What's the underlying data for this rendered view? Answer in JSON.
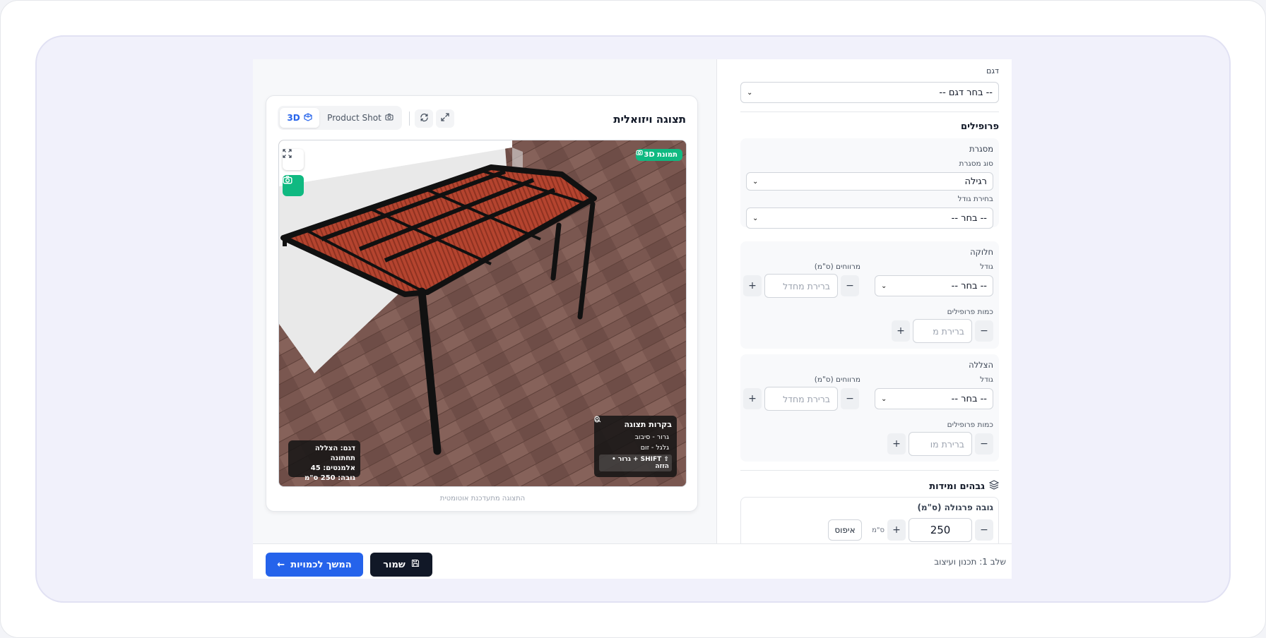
{
  "visualization": {
    "title": "תצוגה ויזואלית",
    "tabs": {
      "tab_3d": "3D",
      "tab_product_shot": "Product Shot"
    },
    "badge": "תמונת 3D",
    "controls": {
      "title": "בקרות תצוגה",
      "drag_rotate": "גרור - סיבוב",
      "scroll_zoom": "גלגל - זום",
      "shift_pan": "SHIFT + גרור • הזזה"
    },
    "info": {
      "model": "דגם: הצללה תחתונה",
      "elements": "אלמנטים: 45",
      "height": "גובה: 250 ס\"מ"
    },
    "caption": "התצוגה מתעדכנת אוטומטית",
    "colors": {
      "accent": "#10b981",
      "slat": "#b5442f",
      "frame": "#111111"
    }
  },
  "config": {
    "model": {
      "label": "דגם",
      "value": "-- בחר דגם --"
    },
    "profiles": {
      "title": "פרופילים",
      "frame": {
        "label": "מסגרת",
        "type_label": "סוג מסגרת",
        "type_value": "רגילה",
        "size_label": "בחירת גודל",
        "size_value": "-- בחר --"
      },
      "divider": {
        "label": "חלוקה",
        "size_label": "גודל",
        "size_value": "-- בחר --",
        "gap_label": "מרווחים (ס\"מ)",
        "gap_placeholder": "ברירת מחדל",
        "count_label": "כמות פרופילים",
        "count_placeholder": "ברירת מ"
      },
      "shading": {
        "label": "הצללה",
        "size_label": "גודל",
        "size_value": "-- בחר --",
        "gap_label": "מרווחים (ס\"מ)",
        "gap_placeholder": "ברירת מחדל",
        "count_label": "כמות פרופילים",
        "count_placeholder": "ברירת מו"
      }
    },
    "dimensions": {
      "title": "גבהים ומידות",
      "pergola_height_label": "גובה פרגולה (ס\"מ)",
      "pergola_height_value": "250",
      "unit": "ס\"מ",
      "reset": "איפוס"
    },
    "stepper": {
      "minus": "−",
      "plus": "+"
    }
  },
  "footer": {
    "step": "שלב 1: תכנון ועיצוב",
    "save": "שמור",
    "continue": "המשך לכמויות"
  }
}
